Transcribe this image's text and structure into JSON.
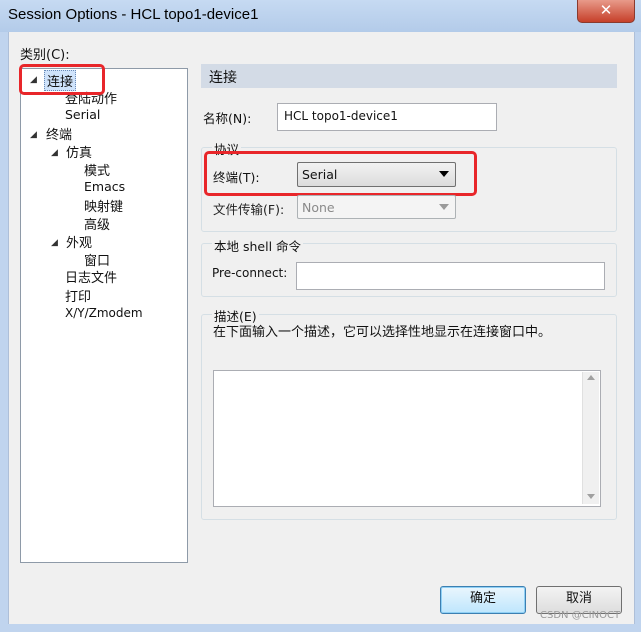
{
  "window": {
    "title": "Session Options - HCL topo1-device1",
    "close_glyph": "✕"
  },
  "category_label": "类别(C):",
  "tree": {
    "items": [
      {
        "label": "连接"
      },
      {
        "label": "登陆动作"
      },
      {
        "label": "Serial"
      },
      {
        "label": "终端"
      },
      {
        "label": "仿真"
      },
      {
        "label": "模式"
      },
      {
        "label": "Emacs"
      },
      {
        "label": "映射键"
      },
      {
        "label": "高级"
      },
      {
        "label": "外观"
      },
      {
        "label": "窗口"
      },
      {
        "label": "日志文件"
      },
      {
        "label": "打印"
      },
      {
        "label": "X/Y/Zmodem"
      }
    ]
  },
  "panel": {
    "header": "连接",
    "name_label": "名称(N):",
    "name_value": "HCL topo1-device1",
    "protocol_group": "协议",
    "terminal_label": "终端(T):",
    "terminal_value": "Serial",
    "filetransfer_label": "文件传输(F):",
    "filetransfer_value": "None",
    "shell_group": "本地 shell 命令",
    "preconnect_label": "Pre-connect:",
    "preconnect_value": "",
    "desc_label": "描述(E)",
    "desc_hint": "在下面输入一个描述，它可以选择性地显示在连接窗口中。",
    "desc_value": ""
  },
  "buttons": {
    "ok": "确定",
    "cancel": "取消"
  },
  "watermark": "CSDN @CINOCT",
  "colors": {
    "highlight": "#e8262a",
    "header_bg": "#d3dbe6",
    "selection": "#cfe3fb"
  }
}
